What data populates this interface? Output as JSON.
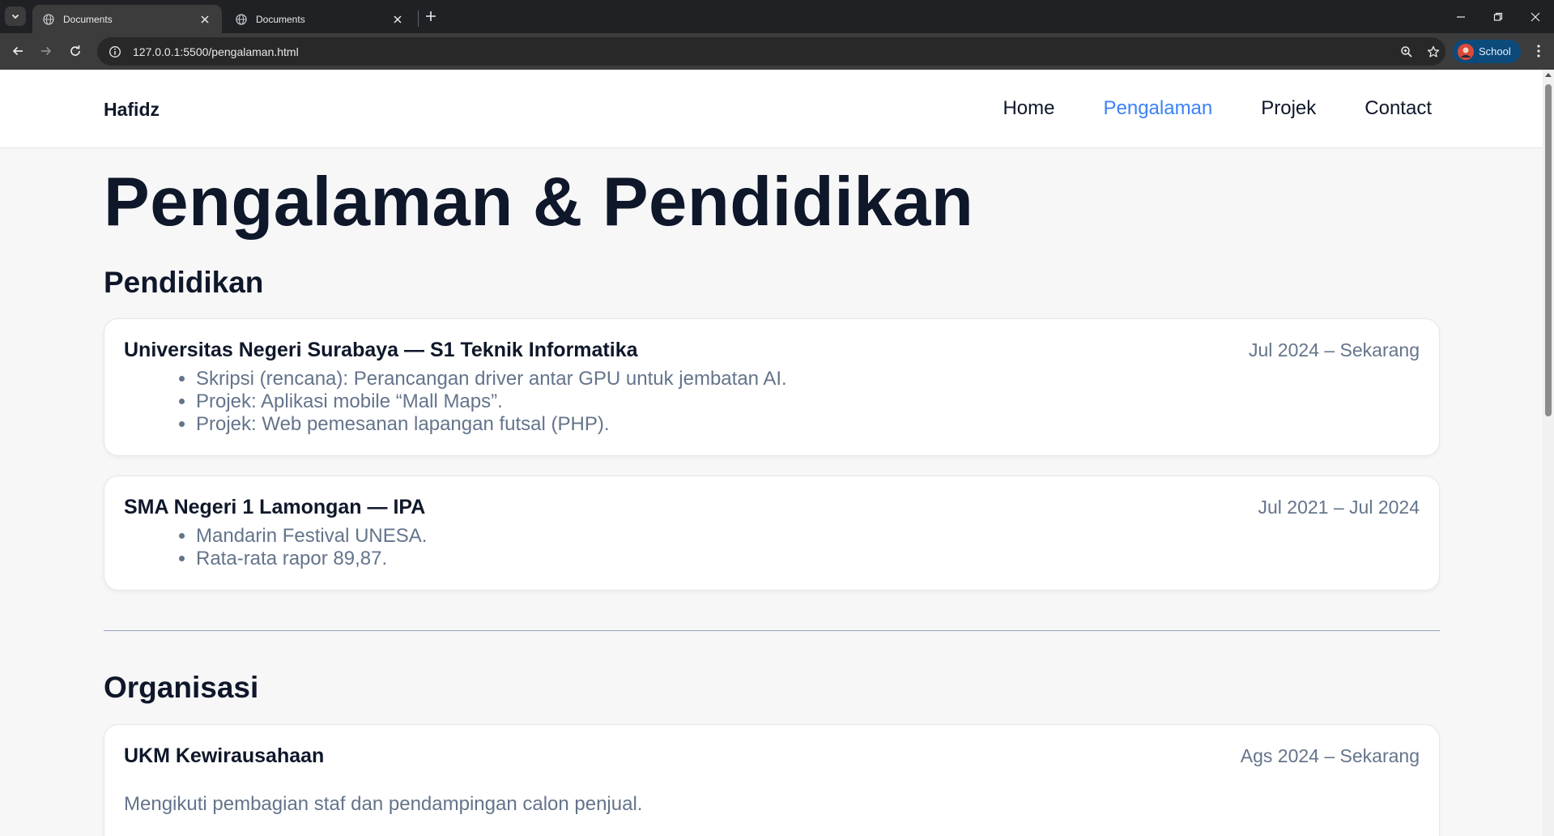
{
  "browser": {
    "tabs": [
      {
        "title": "Documents",
        "active": true
      },
      {
        "title": "Documents",
        "active": false
      }
    ],
    "url": "127.0.0.1:5500/pengalaman.html",
    "profile_label": "School"
  },
  "site": {
    "brand": "Hafidz",
    "nav": [
      {
        "label": "Home",
        "active": false
      },
      {
        "label": "Pengalaman",
        "active": true
      },
      {
        "label": "Projek",
        "active": false
      },
      {
        "label": "Contact",
        "active": false
      }
    ],
    "accent_color": "#3b82f6"
  },
  "page": {
    "title": "Pengalaman & Pendidikan",
    "pendidikan": {
      "heading": "Pendidikan",
      "items": [
        {
          "title": "Universitas Negeri Surabaya — S1 Teknik Informatika",
          "date": "Jul 2024 – Sekarang",
          "bullets": [
            "Skripsi (rencana): Perancangan driver antar GPU untuk jembatan AI.",
            "Projek: Aplikasi mobile “Mall Maps”.",
            "Projek: Web pemesanan lapangan futsal (PHP)."
          ]
        },
        {
          "title": "SMA Negeri 1 Lamongan — IPA",
          "date": "Jul 2021 – Jul 2024",
          "bullets": [
            "Mandarin Festival UNESA.",
            "Rata-rata rapor 89,87."
          ]
        }
      ]
    },
    "organisasi": {
      "heading": "Organisasi",
      "items": [
        {
          "title": "UKM Kewirausahaan",
          "date": "Ags 2024 – Sekarang",
          "description": "Mengikuti pembagian staf dan pendampingan calon penjual."
        }
      ]
    }
  }
}
